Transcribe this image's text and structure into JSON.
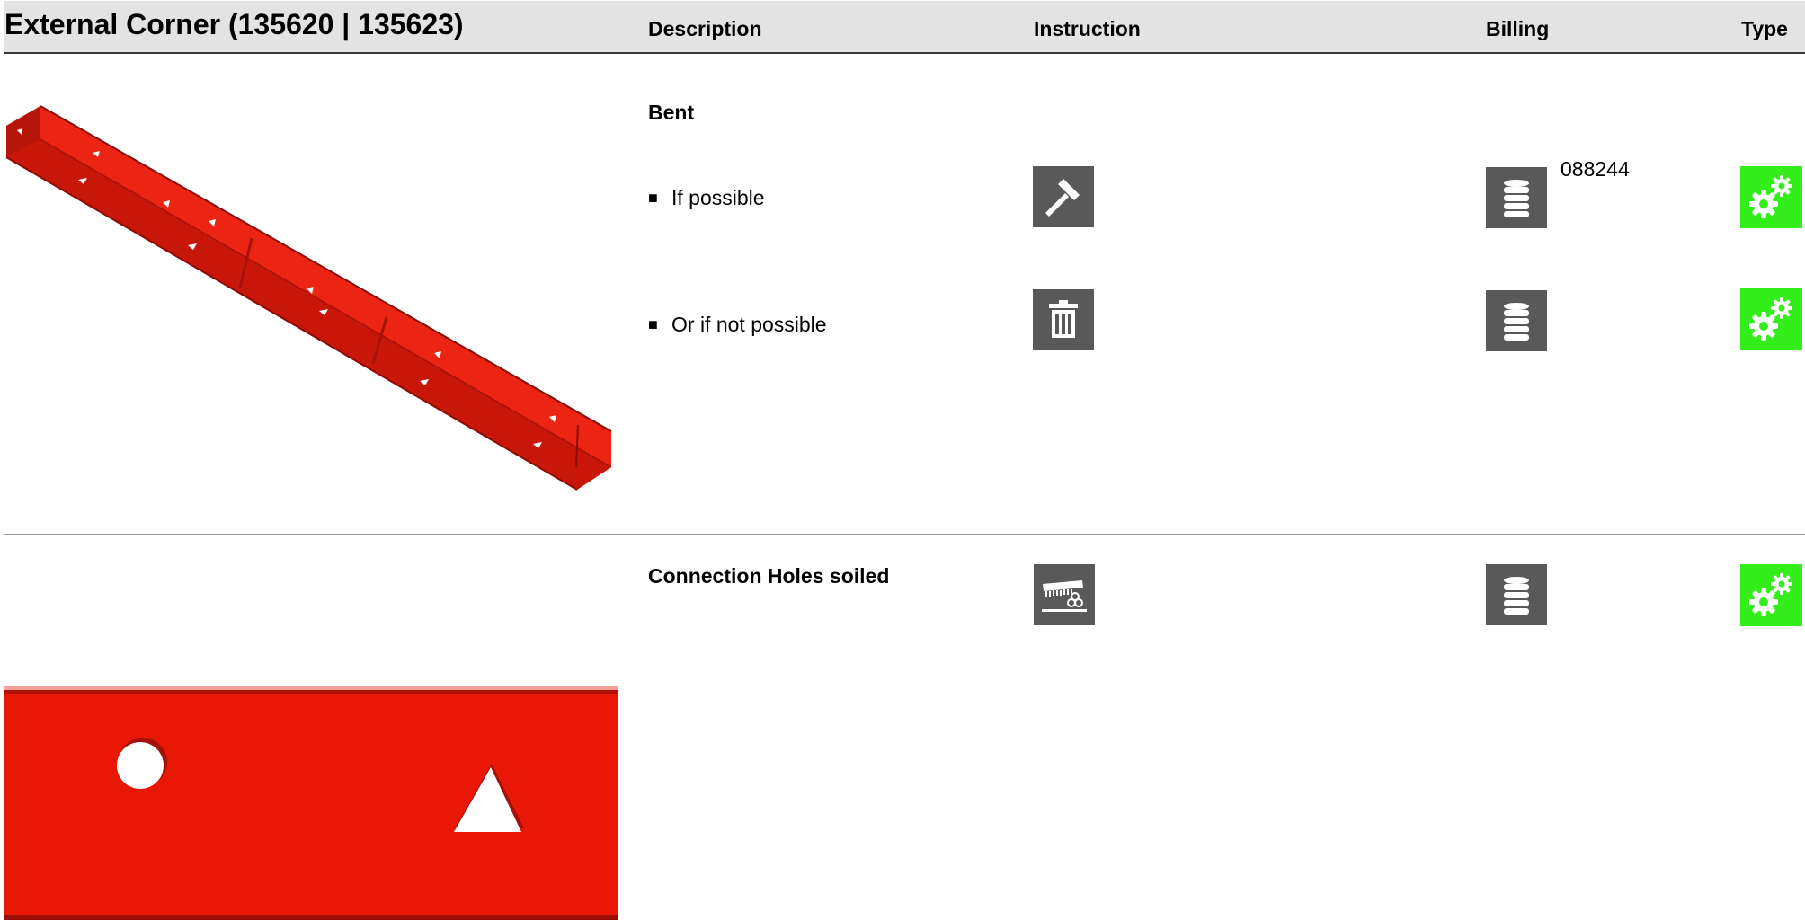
{
  "header": {
    "title": "External Corner (135620 | 135623)",
    "columns": {
      "description": "Description",
      "instruction": "Instruction",
      "billing": "Billing",
      "type": "Type"
    }
  },
  "sections": [
    {
      "heading": "Bent",
      "rows": [
        {
          "description": "If possible",
          "instruction_icon": "hammer-icon",
          "billing_icon": "coin-stack-icon",
          "billing_code": "088244",
          "type_icon": "gears-icon"
        },
        {
          "description": "Or if not possible",
          "instruction_icon": "trash-icon",
          "billing_icon": "coin-stack-icon",
          "billing_code": "",
          "type_icon": "gears-icon"
        }
      ]
    },
    {
      "heading": "Connection Holes soiled",
      "rows": [
        {
          "description": "",
          "instruction_icon": "cleaning-brush-icon",
          "billing_icon": "coin-stack-icon",
          "billing_code": "",
          "type_icon": "gears-icon"
        }
      ]
    }
  ],
  "colors": {
    "header_bg": "#e3e3e3",
    "icon_tile": "#595959",
    "type_tile": "#33ee1a",
    "part_red": "#e81706"
  }
}
